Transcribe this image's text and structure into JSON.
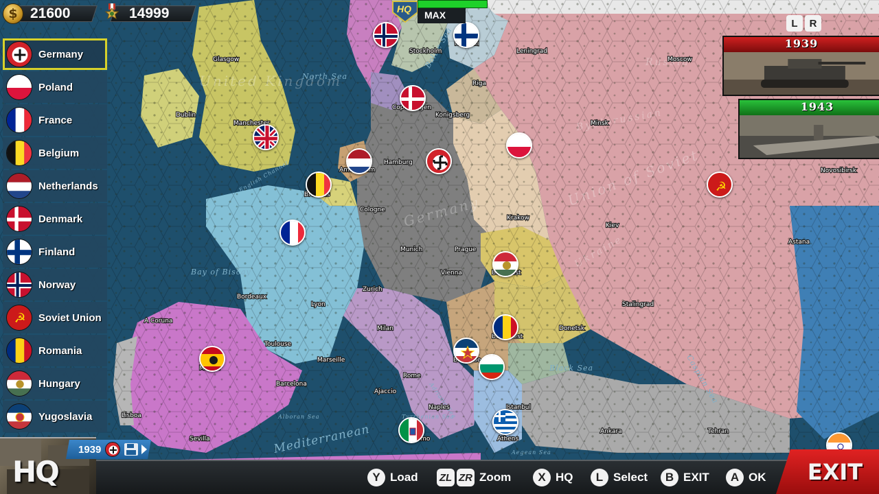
{
  "resources": {
    "money": "21600",
    "medals": "14999"
  },
  "hq": {
    "label": "HQ",
    "level": "MAX"
  },
  "shoulder_buttons": [
    "L",
    "R"
  ],
  "scenarios": [
    {
      "year": "1939",
      "color": "#b01818"
    },
    {
      "year": "1943",
      "color": "#1aa52a"
    }
  ],
  "countries": [
    {
      "name": "Germany",
      "flag": "germany",
      "selected": true
    },
    {
      "name": "Poland",
      "flag": "poland"
    },
    {
      "name": "France",
      "flag": "france"
    },
    {
      "name": "Belgium",
      "flag": "belgium"
    },
    {
      "name": "Netherlands",
      "flag": "netherlands"
    },
    {
      "name": "Denmark",
      "flag": "denmark"
    },
    {
      "name": "Finland",
      "flag": "finland"
    },
    {
      "name": "Norway",
      "flag": "norway"
    },
    {
      "name": "Soviet Union",
      "flag": "soviet"
    },
    {
      "name": "Romania",
      "flag": "romania"
    },
    {
      "name": "Hungary",
      "flag": "hungary"
    },
    {
      "name": "Yugoslavia",
      "flag": "yugoslavia"
    }
  ],
  "cities": [
    "Glasgow",
    "Stockholm",
    "Helsinki",
    "Leningrad",
    "Moscow",
    "Dublin",
    "Manchester",
    "Copenhagen",
    "Konigsberg",
    "Riga",
    "Minsk",
    "Amsterdam",
    "Hamburg",
    "Brussels",
    "Cologne",
    "Krakow",
    "Kiev",
    "Novosibirsk",
    "Munich",
    "Prague",
    "Vienna",
    "Budapest",
    "Astana",
    "Bordeaux",
    "Lyon",
    "Zurich",
    "Stalingrad",
    "A Coruna",
    "Milan",
    "Bucharest",
    "Donetsk",
    "Toulouse",
    "Marseille",
    "Belgrade",
    "Madrid",
    "Barcelona",
    "Rome",
    "Ajaccio",
    "Istanbul",
    "Naples",
    "Lisboa",
    "Palermo",
    "Ankara",
    "Tehran",
    "Sevilla",
    "Athens"
  ],
  "seas": [
    "North Sea",
    "Baltic Sea",
    "Bay of Biscay",
    "Black Sea",
    "Caspian Sea",
    "Mediterranean",
    "English Channel",
    "Adriatic Sea",
    "Tyrrhenian Sea",
    "Aegean Sea",
    "Alboran Sea"
  ],
  "regions": [
    "United Kingdom",
    "Germany",
    "Union of Soviet",
    "Byelorussian",
    "Russia",
    "Ukraine"
  ],
  "bottom": {
    "hq_box": "HQ",
    "save_year": "1939",
    "buttons": [
      {
        "key": "Y",
        "label": "Load"
      },
      {
        "keys": [
          "ZL",
          "ZR"
        ],
        "label": "Zoom"
      },
      {
        "key": "X",
        "label": "HQ"
      },
      {
        "key": "L",
        "label": "Select"
      },
      {
        "key": "B",
        "label": "EXIT"
      },
      {
        "key": "A",
        "label": "OK"
      }
    ],
    "exit_label": "EXIT"
  },
  "colors": {
    "selection": "#d7d12a",
    "hq_bar": "#1ed12a",
    "exit": "#d01a1a"
  }
}
